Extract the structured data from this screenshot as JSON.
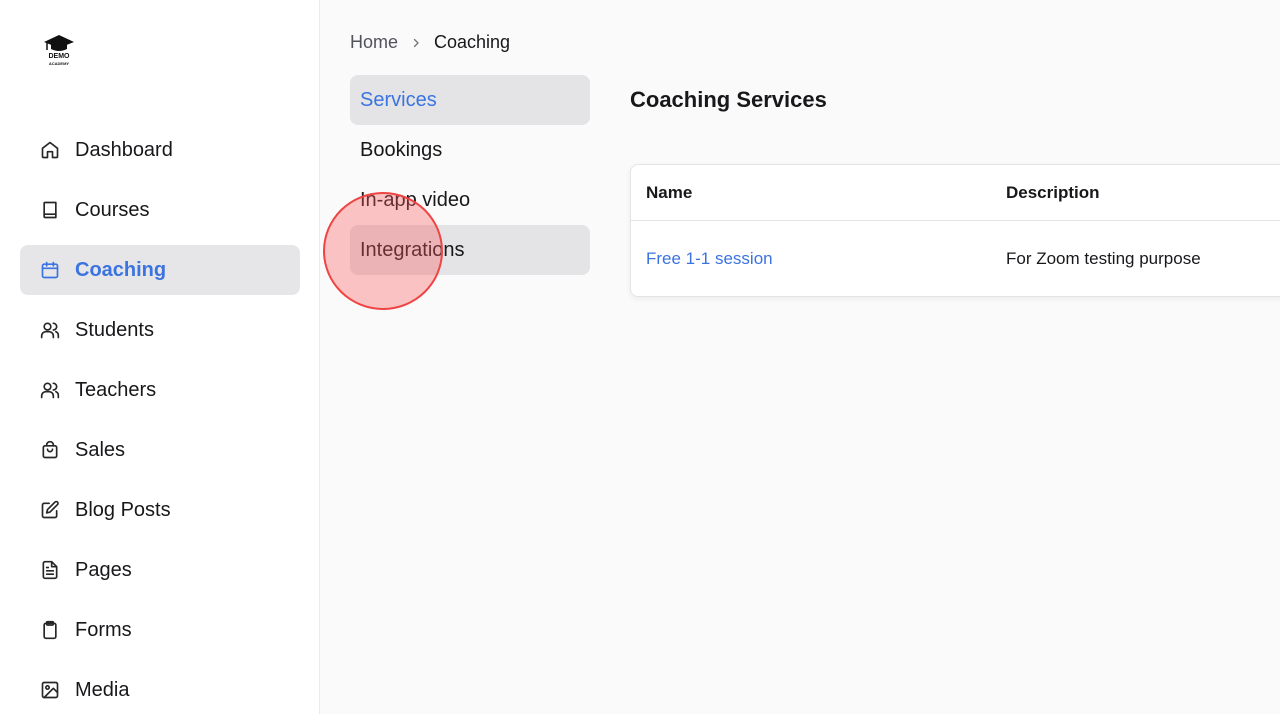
{
  "logo": {
    "line1": "DEMO",
    "line2": "ACADEMY"
  },
  "sidebar": {
    "items": [
      {
        "label": "Dashboard",
        "icon": "home-icon"
      },
      {
        "label": "Courses",
        "icon": "book-icon"
      },
      {
        "label": "Coaching",
        "icon": "calendar-icon",
        "active": true
      },
      {
        "label": "Students",
        "icon": "users-icon"
      },
      {
        "label": "Teachers",
        "icon": "users-icon"
      },
      {
        "label": "Sales",
        "icon": "shopping-bag-icon"
      },
      {
        "label": "Blog Posts",
        "icon": "edit-icon"
      },
      {
        "label": "Pages",
        "icon": "document-icon"
      },
      {
        "label": "Forms",
        "icon": "clipboard-icon"
      },
      {
        "label": "Media",
        "icon": "image-icon"
      }
    ]
  },
  "breadcrumb": {
    "home": "Home",
    "current": "Coaching"
  },
  "subnav": {
    "items": [
      {
        "label": "Services",
        "active": true
      },
      {
        "label": "Bookings"
      },
      {
        "label": "In-app video"
      },
      {
        "label": "Integrations"
      }
    ]
  },
  "main": {
    "title": "Coaching Services",
    "table": {
      "headers": [
        "Name",
        "Description"
      ],
      "rows": [
        {
          "name": "Free 1-1 session",
          "description": "For Zoom testing purpose"
        }
      ]
    }
  },
  "colors": {
    "accent": "#3b73e0",
    "active_bg": "#e6e6e8",
    "click_marker": "#ef4444"
  }
}
